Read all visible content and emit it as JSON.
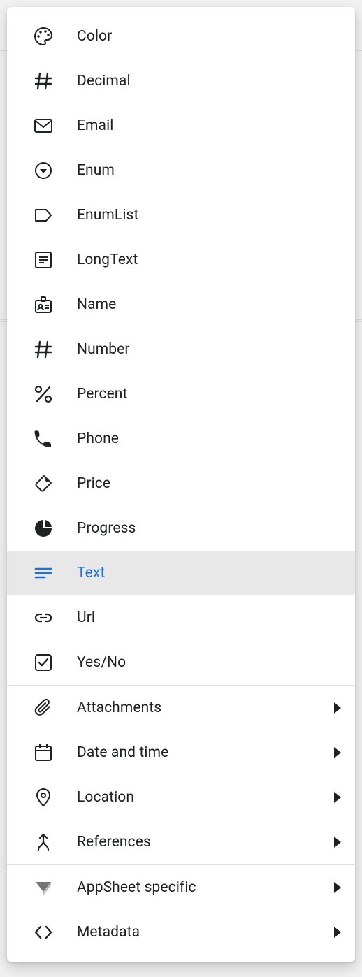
{
  "colors": {
    "accent": "#1a73e8",
    "text": "#202124",
    "selected_bg": "#e8e8e8"
  },
  "menu": {
    "items": [
      {
        "label": "Color",
        "icon": "palette-icon",
        "submenu": false
      },
      {
        "label": "Decimal",
        "icon": "hash-icon",
        "submenu": false
      },
      {
        "label": "Email",
        "icon": "email-icon",
        "submenu": false
      },
      {
        "label": "Enum",
        "icon": "enum-icon",
        "submenu": false
      },
      {
        "label": "EnumList",
        "icon": "label-icon",
        "submenu": false
      },
      {
        "label": "LongText",
        "icon": "article-icon",
        "submenu": false
      },
      {
        "label": "Name",
        "icon": "badge-icon",
        "submenu": false
      },
      {
        "label": "Number",
        "icon": "hash-icon",
        "submenu": false
      },
      {
        "label": "Percent",
        "icon": "percent-icon",
        "submenu": false
      },
      {
        "label": "Phone",
        "icon": "phone-icon",
        "submenu": false
      },
      {
        "label": "Price",
        "icon": "tag-icon",
        "submenu": false
      },
      {
        "label": "Progress",
        "icon": "pie-icon",
        "submenu": false
      },
      {
        "label": "Text",
        "icon": "notes-icon",
        "submenu": false,
        "selected": true
      },
      {
        "label": "Url",
        "icon": "link-icon",
        "submenu": false
      },
      {
        "label": "Yes/No",
        "icon": "checkbox-icon",
        "submenu": false
      },
      {
        "divider": true
      },
      {
        "label": "Attachments",
        "icon": "attachment-icon",
        "submenu": true
      },
      {
        "label": "Date and time",
        "icon": "calendar-icon",
        "submenu": true
      },
      {
        "label": "Location",
        "icon": "location-icon",
        "submenu": true
      },
      {
        "label": "References",
        "icon": "merge-icon",
        "submenu": true
      },
      {
        "divider": true
      },
      {
        "label": "AppSheet specific",
        "icon": "appsheet-icon",
        "submenu": true
      },
      {
        "label": "Metadata",
        "icon": "code-icon",
        "submenu": true
      }
    ]
  }
}
